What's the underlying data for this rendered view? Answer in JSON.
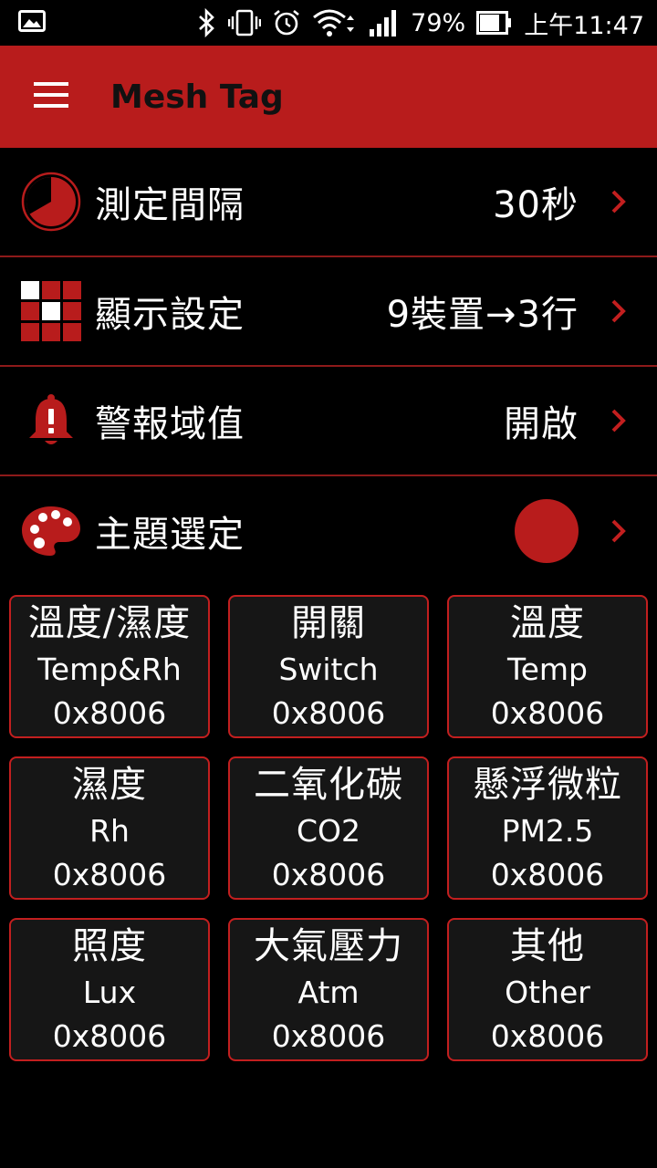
{
  "status_bar": {
    "battery_percent": "79%",
    "time": "上午11:47"
  },
  "app_bar": {
    "title": "Mesh Tag"
  },
  "settings": [
    {
      "label": "測定間隔",
      "value": "30秒",
      "icon": "pie-clock-icon"
    },
    {
      "label": "顯示設定",
      "value": "9裝置→3行",
      "icon": "grid-layout-icon"
    },
    {
      "label": "警報域值",
      "value": "開啟",
      "icon": "bell-alert-icon"
    },
    {
      "label": "主題選定",
      "value": "",
      "icon": "palette-icon",
      "swatch_color": "#b81c1c"
    }
  ],
  "devices": [
    {
      "zh": "溫度/濕度",
      "en": "Temp&Rh",
      "addr": "0x8006"
    },
    {
      "zh": "開關",
      "en": "Switch",
      "addr": "0x8006"
    },
    {
      "zh": "溫度",
      "en": "Temp",
      "addr": "0x8006"
    },
    {
      "zh": "濕度",
      "en": "Rh",
      "addr": "0x8006"
    },
    {
      "zh": "二氧化碳",
      "en": "CO2",
      "addr": "0x8006"
    },
    {
      "zh": "懸浮微粒",
      "en": "PM2.5",
      "addr": "0x8006"
    },
    {
      "zh": "照度",
      "en": "Lux",
      "addr": "0x8006"
    },
    {
      "zh": "大氣壓力",
      "en": "Atm",
      "addr": "0x8006"
    },
    {
      "zh": "其他",
      "en": "Other",
      "addr": "0x8006"
    }
  ],
  "colors": {
    "accent": "#b81c1c",
    "background": "#000000",
    "card_background": "#161616",
    "divider": "#8e1a1a"
  }
}
